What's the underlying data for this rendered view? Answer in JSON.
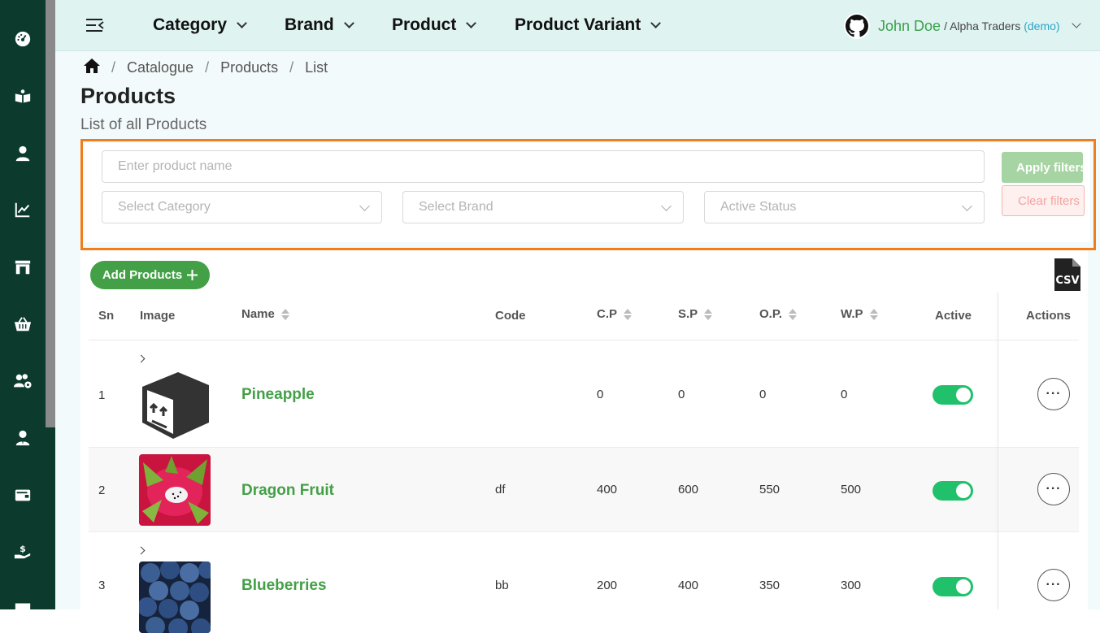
{
  "sidebar": {
    "items": [
      {
        "icon": "dashboard-icon"
      },
      {
        "icon": "catalogue-icon"
      },
      {
        "icon": "user-icon"
      },
      {
        "icon": "chart-icon"
      },
      {
        "icon": "store-icon"
      },
      {
        "icon": "basket-icon"
      },
      {
        "icon": "users-settings-icon"
      },
      {
        "icon": "staff-icon"
      },
      {
        "icon": "wallet-icon"
      },
      {
        "icon": "payment-hand-icon"
      },
      {
        "icon": "money-icon"
      }
    ]
  },
  "topbar": {
    "nav": [
      "Category",
      "Brand",
      "Product",
      "Product Variant"
    ],
    "user": {
      "name": "John Doe",
      "org": "/ Alpha Traders",
      "tag": "(demo)"
    }
  },
  "breadcrumb": [
    "Catalogue",
    "Products",
    "List"
  ],
  "page": {
    "title": "Products",
    "subtitle": "List of all Products"
  },
  "filters": {
    "search_placeholder": "Enter product name",
    "category_placeholder": "Select Category",
    "brand_placeholder": "Select Brand",
    "status_placeholder": "Active Status",
    "apply_label": "Apply filters",
    "clear_label": "Clear filters"
  },
  "toolbar": {
    "add_label": "Add Products",
    "csv_label": "CSV"
  },
  "table": {
    "headers": {
      "sn": "Sn",
      "image": "Image",
      "name": "Name",
      "code": "Code",
      "cp": "C.P",
      "sp": "S.P",
      "op": "O.P.",
      "wp": "W.P",
      "active": "Active",
      "actions": "Actions"
    },
    "rows": [
      {
        "sn": "1",
        "name": "Pineapple",
        "code": "",
        "cp": "0",
        "sp": "0",
        "op": "0",
        "wp": "0",
        "active": true,
        "image": "box-placeholder"
      },
      {
        "sn": "2",
        "name": "Dragon Fruit",
        "code": "df",
        "cp": "400",
        "sp": "600",
        "op": "550",
        "wp": "500",
        "active": true,
        "image": "dragon-fruit-photo"
      },
      {
        "sn": "3",
        "name": "Blueberries",
        "code": "bb",
        "cp": "200",
        "sp": "400",
        "op": "350",
        "wp": "300",
        "active": true,
        "image": "blueberries-photo"
      }
    ]
  },
  "colors": {
    "sidebar": "#0c3b2e",
    "accent_green": "#43a047",
    "toggle_on": "#21c16b",
    "filter_outline": "#f07d1a",
    "topbar": "#dff3f1"
  }
}
